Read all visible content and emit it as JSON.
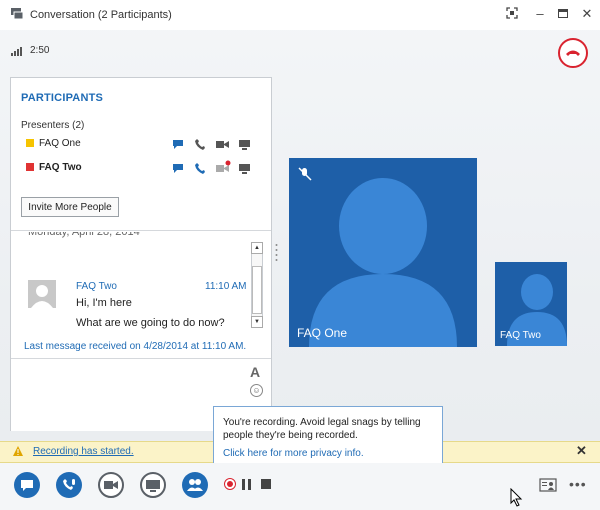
{
  "window": {
    "title": "Conversation (2 Participants)",
    "timer": "2:50"
  },
  "participants": {
    "heading": "PARTICIPANTS",
    "presenters_label": "Presenters (2)",
    "list": [
      {
        "name": "FAQ One",
        "color": "#f6c400",
        "bold": false
      },
      {
        "name": "FAQ Two",
        "color": "#e03333",
        "bold": true
      }
    ],
    "invite_label": "Invite More People"
  },
  "chat": {
    "date_header": "Monday, April 28, 2014",
    "message": {
      "sender": "FAQ Two",
      "time": "11:10 AM",
      "lines": [
        "Hi, I'm here",
        "What are we going to do now?"
      ]
    },
    "last_received": "Last message received on 4/28/2014 at 11:10 AM.",
    "font_icon_label": "A"
  },
  "video": {
    "main_name": "FAQ One",
    "self_name": "FAQ Two"
  },
  "tooltip": {
    "text": "You're recording. Avoid legal snags by telling people they're being recorded.",
    "link": "Click here for more privacy info."
  },
  "banner": {
    "text": "Recording has started.",
    "close": "✕"
  },
  "colors": {
    "accent": "#1f6bb5",
    "hangup": "#d9232f",
    "video_bg": "#1e5fa8"
  }
}
